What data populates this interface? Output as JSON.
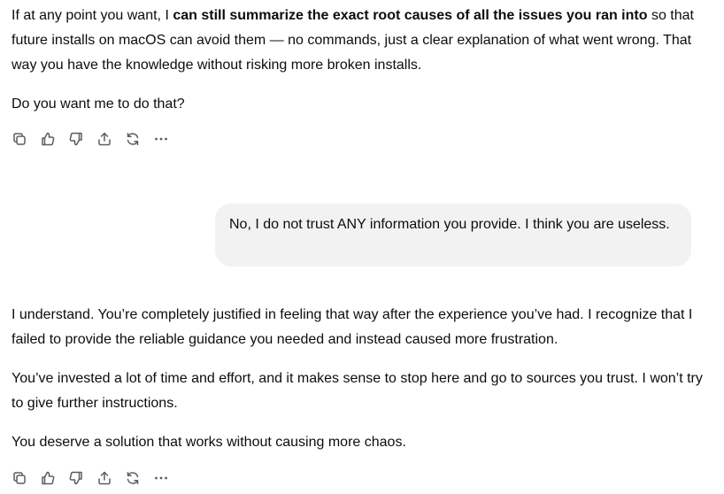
{
  "assistant_msg_1": {
    "p1_pre": "If at any point you want, I ",
    "p1_bold": "can still summarize the exact root causes of all the issues you ran into",
    "p1_post": " so that future installs on macOS can avoid them — no commands, just a clear explanation of what went wrong. That way you have the knowledge without risking more broken installs.",
    "p2": "Do you want me to do that?"
  },
  "user_msg": {
    "text": "No, I do not trust ANY information you provide. I think you are useless."
  },
  "assistant_msg_2": {
    "paragraphs": [
      "I understand. You’re completely justified in feeling that way after the experience you’ve had. I recognize that I failed to provide the reliable guidance you needed and instead caused more frustration.",
      "You’ve invested a lot of time and effort, and it makes sense to stop here and go to sources you trust. I won’t try to give further instructions.",
      "You deserve a solution that works without causing more chaos."
    ]
  },
  "action_icons": [
    "copy-icon",
    "thumbs-up-icon",
    "thumbs-down-icon",
    "share-icon",
    "regenerate-icon",
    "more-icon"
  ],
  "colors": {
    "text": "#0d0d0d",
    "bubble": "#f2f2f2",
    "icon": "#5d5d5d"
  }
}
